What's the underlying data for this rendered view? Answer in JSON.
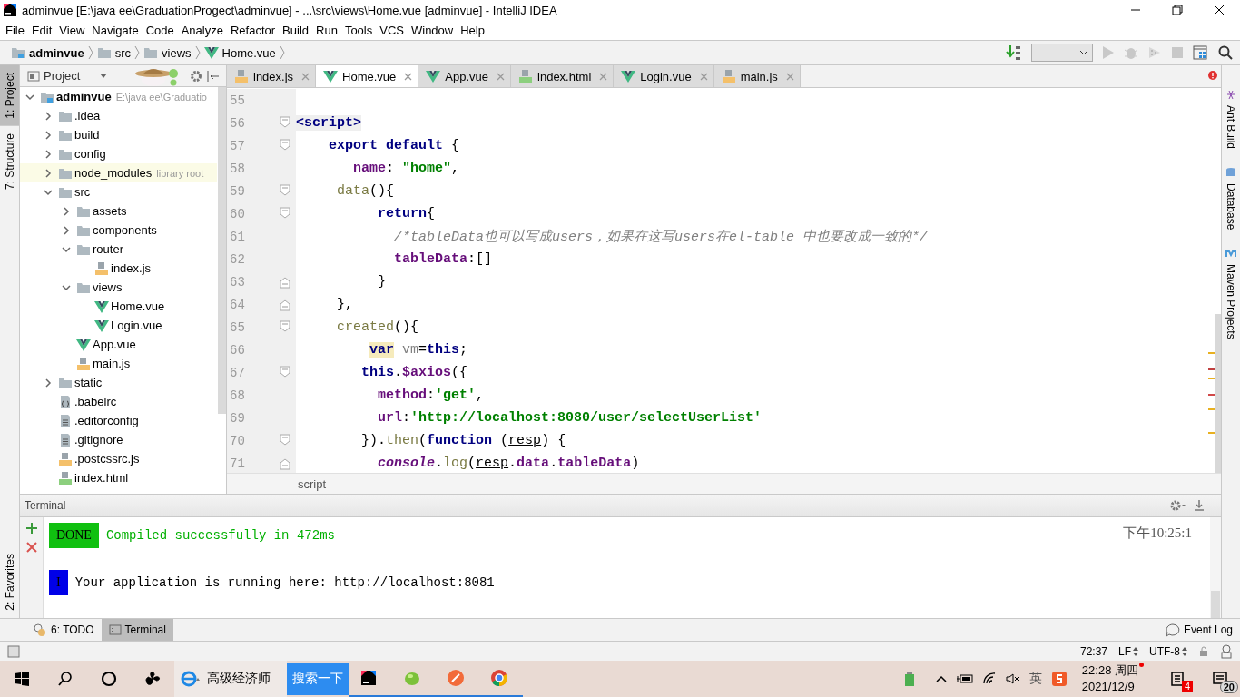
{
  "window": {
    "title": "adminvue [E:\\java ee\\GraduationProgect\\adminvue] - ...\\src\\views\\Home.vue [adminvue] - IntelliJ IDEA"
  },
  "menu": [
    "File",
    "Edit",
    "View",
    "Navigate",
    "Code",
    "Analyze",
    "Refactor",
    "Build",
    "Run",
    "Tools",
    "VCS",
    "Window",
    "Help"
  ],
  "breadcrumb": [
    {
      "label": "adminvue",
      "kind": "project"
    },
    {
      "label": "src",
      "kind": "folder"
    },
    {
      "label": "views",
      "kind": "folder"
    },
    {
      "label": "Home.vue",
      "kind": "vue"
    }
  ],
  "left_tool_strip": [
    {
      "label": "1: Project",
      "selected": true
    },
    {
      "label": "7: Structure",
      "selected": false
    },
    {
      "label": "2: Favorites",
      "selected": false
    }
  ],
  "right_tool_strip": [
    "Ant Build",
    "Database",
    "Maven Projects"
  ],
  "project_panel": {
    "title": "Project",
    "tree": [
      {
        "label": "adminvue",
        "hint": "E:\\java ee\\Graduatio",
        "kind": "project",
        "expanded": true,
        "children": [
          {
            "label": ".idea",
            "kind": "folder",
            "expanded": false
          },
          {
            "label": "build",
            "kind": "folder",
            "expanded": false
          },
          {
            "label": "config",
            "kind": "folder",
            "expanded": false
          },
          {
            "label": "node_modules",
            "hint": "library root",
            "library": true,
            "kind": "folder",
            "expanded": false
          },
          {
            "label": "src",
            "kind": "folder",
            "expanded": true,
            "children": [
              {
                "label": "assets",
                "kind": "folder",
                "expanded": false
              },
              {
                "label": "components",
                "kind": "folder",
                "expanded": false
              },
              {
                "label": "router",
                "kind": "folder",
                "expanded": true,
                "children": [
                  {
                    "label": "index.js",
                    "kind": "js"
                  }
                ]
              },
              {
                "label": "views",
                "kind": "folder",
                "expanded": true,
                "children": [
                  {
                    "label": "Home.vue",
                    "kind": "vue"
                  },
                  {
                    "label": "Login.vue",
                    "kind": "vue"
                  }
                ]
              },
              {
                "label": "App.vue",
                "kind": "vue"
              },
              {
                "label": "main.js",
                "kind": "js"
              }
            ]
          },
          {
            "label": "static",
            "kind": "folder",
            "expanded": false
          },
          {
            "label": ".babelrc",
            "kind": "json"
          },
          {
            "label": ".editorconfig",
            "kind": "text"
          },
          {
            "label": ".gitignore",
            "kind": "text"
          },
          {
            "label": ".postcssrc.js",
            "kind": "js"
          },
          {
            "label": "index.html",
            "kind": "html"
          }
        ]
      }
    ]
  },
  "editor": {
    "tabs": [
      {
        "label": "index.js",
        "kind": "js",
        "selected": false
      },
      {
        "label": "Home.vue",
        "kind": "vue",
        "selected": true
      },
      {
        "label": "App.vue",
        "kind": "vue",
        "selected": false
      },
      {
        "label": "index.html",
        "kind": "html",
        "selected": false
      },
      {
        "label": "Login.vue",
        "kind": "vue",
        "selected": false
      },
      {
        "label": "main.js",
        "kind": "js",
        "selected": false
      }
    ],
    "lines": [
      {
        "number": "55",
        "kind": "plain"
      },
      {
        "number": "56",
        "kind": "fold-start",
        "tokens": [
          {
            "text": "<script>",
            "kind": "tag"
          }
        ]
      },
      {
        "number": "57",
        "kind": "fold-start",
        "tokens": [
          {
            "text": "    export default",
            "kind": "keyword"
          },
          {
            "text": " {",
            "kind": "plain"
          }
        ]
      },
      {
        "number": "58",
        "kind": "plain",
        "tokens": [
          {
            "text": "       name",
            "kind": "prop"
          },
          {
            "text": ": ",
            "kind": "plain"
          },
          {
            "text": "\"home\"",
            "kind": "string"
          },
          {
            "text": ",",
            "kind": "plain"
          }
        ]
      },
      {
        "number": "59",
        "kind": "fold-start",
        "tokens": [
          {
            "text": "     data",
            "kind": "func"
          },
          {
            "text": "(){",
            "kind": "plain"
          }
        ]
      },
      {
        "number": "60",
        "kind": "fold-start",
        "tokens": [
          {
            "text": "          return",
            "kind": "keyword"
          },
          {
            "text": "{",
            "kind": "plain"
          }
        ]
      },
      {
        "number": "61",
        "kind": "plain",
        "tokens": [
          {
            "text": "            /*tableData也可以写成users，如果在这写users在el-table 中也要改成一致的*/",
            "kind": "comment"
          }
        ]
      },
      {
        "number": "62",
        "kind": "plain",
        "tokens": [
          {
            "text": "            tableData",
            "kind": "prop"
          },
          {
            "text": ":[]",
            "kind": "plain"
          }
        ]
      },
      {
        "number": "63",
        "kind": "fold-end",
        "tokens": [
          {
            "text": "          }",
            "kind": "plain"
          }
        ]
      },
      {
        "number": "64",
        "kind": "fold-end",
        "tokens": [
          {
            "text": "     },",
            "kind": "plain"
          }
        ]
      },
      {
        "number": "65",
        "kind": "fold-start",
        "tokens": [
          {
            "text": "     created",
            "kind": "func"
          },
          {
            "text": "(){",
            "kind": "plain"
          }
        ]
      },
      {
        "number": "66",
        "kind": "plain",
        "tokens": [
          {
            "text": "         var",
            "kind": "highlight"
          },
          {
            "text": " vm",
            "kind": "local"
          },
          {
            "text": "=",
            "kind": "plain"
          },
          {
            "text": "this",
            "kind": "keyword"
          },
          {
            "text": ";",
            "kind": "plain"
          }
        ]
      },
      {
        "number": "67",
        "kind": "fold-start",
        "tokens": [
          {
            "text": "        this",
            "kind": "keyword"
          },
          {
            "text": ".",
            "kind": "plain"
          },
          {
            "text": "$axios",
            "kind": "prop"
          },
          {
            "text": "({",
            "kind": "plain"
          }
        ]
      },
      {
        "number": "68",
        "kind": "plain",
        "tokens": [
          {
            "text": "          method",
            "kind": "prop"
          },
          {
            "text": ":",
            "kind": "plain"
          },
          {
            "text": "'get'",
            "kind": "string"
          },
          {
            "text": ",",
            "kind": "plain"
          }
        ]
      },
      {
        "number": "69",
        "kind": "plain",
        "tokens": [
          {
            "text": "          url",
            "kind": "prop"
          },
          {
            "text": ":",
            "kind": "plain"
          },
          {
            "text": "'http://localhost:8080/user/selectUserList'",
            "kind": "string"
          }
        ]
      },
      {
        "number": "70",
        "kind": "fold-start",
        "tokens": [
          {
            "text": "        }).",
            "kind": "plain"
          },
          {
            "text": "then",
            "kind": "func"
          },
          {
            "text": "(",
            "kind": "plain"
          },
          {
            "text": "function",
            "kind": "keyword"
          },
          {
            "text": " (",
            "kind": "plain"
          },
          {
            "text": "resp",
            "kind": "param"
          },
          {
            "text": ") {",
            "kind": "plain"
          }
        ]
      },
      {
        "number": "71",
        "kind": "fold-end",
        "tokens": [
          {
            "text": "          console",
            "kind": "console"
          },
          {
            "text": ".",
            "kind": "plain"
          },
          {
            "text": "log",
            "kind": "func"
          },
          {
            "text": "(",
            "kind": "plain"
          },
          {
            "text": "resp",
            "kind": "param"
          },
          {
            "text": ".",
            "kind": "plain"
          },
          {
            "text": "data",
            "kind": "prop"
          },
          {
            "text": ".",
            "kind": "plain"
          },
          {
            "text": "tableData",
            "kind": "prop"
          },
          {
            "text": ")",
            "kind": "plain"
          }
        ]
      }
    ],
    "breadcrumb": "script"
  },
  "terminal": {
    "title": "Terminal",
    "lines": [
      {
        "badge": "DONE",
        "kind": "success",
        "text": "Compiled successfully in 472ms",
        "time": "下午10:25:1"
      },
      {
        "badge": "I",
        "kind": "info",
        "text": "Your application is running here: http://localhost:8081"
      }
    ]
  },
  "tool_windows": [
    {
      "label": "6: TODO",
      "kind": "todo",
      "selected": false
    },
    {
      "label": "Terminal",
      "kind": "terminal",
      "selected": true
    }
  ],
  "event_log": "Event Log",
  "status_bar": {
    "position": "72:37",
    "line_separator": "LF",
    "encoding": "UTF-8"
  },
  "taskbar": {
    "search_text": "高级经济师",
    "search_button": "搜索一下",
    "time": "22:28 周四",
    "date": "2021/12/9",
    "ime": "英",
    "notifications": "4",
    "action_center": "20"
  }
}
